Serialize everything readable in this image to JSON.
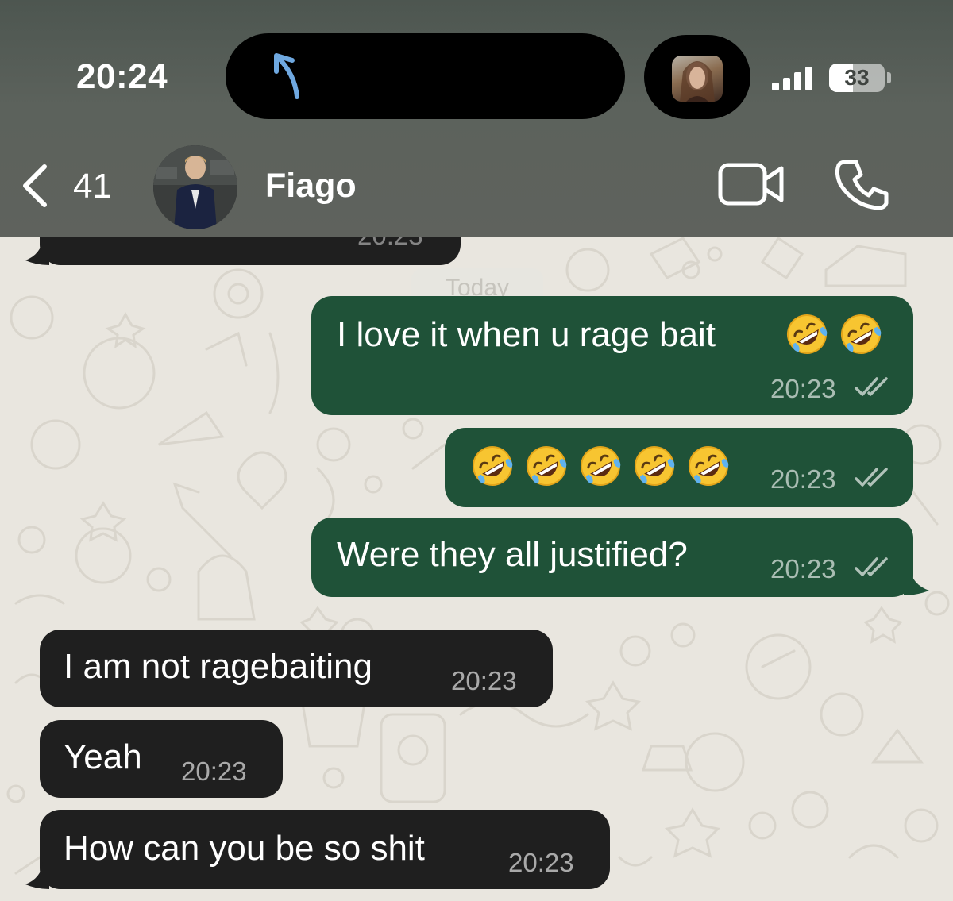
{
  "status_bar": {
    "time": "20:24",
    "battery": "33"
  },
  "header": {
    "back_count": "41",
    "contact_name": "Fiago"
  },
  "chat": {
    "partial_time": "20:23",
    "date_divider": "Today",
    "messages": [
      {
        "direction": "out",
        "text": "I love it when u rage bait",
        "emoji_count": 2,
        "time": "20:23",
        "status": "read"
      },
      {
        "direction": "out",
        "text": "",
        "emoji_count": 5,
        "time": "20:23",
        "status": "read"
      },
      {
        "direction": "out",
        "text": "Were they all justified?",
        "emoji_count": 0,
        "time": "20:23",
        "status": "read"
      },
      {
        "direction": "in",
        "text": "I am not ragebaiting",
        "time": "20:23"
      },
      {
        "direction": "in",
        "text": "Yeah",
        "time": "20:23"
      },
      {
        "direction": "in",
        "text": "How can you be so shit",
        "time": "20:23"
      }
    ]
  },
  "icons": {
    "back": "chevron-left-icon",
    "video_call": "video-camera-icon",
    "voice_call": "phone-icon",
    "emoji": "rolling-on-floor-laughing-emoji",
    "read_receipt": "double-check-icon"
  },
  "colors": {
    "outgoing_bubble": "#1f5238",
    "incoming_bubble": "#1f1f1f",
    "wallpaper": "#e9e6df",
    "header": "#5c625c"
  }
}
